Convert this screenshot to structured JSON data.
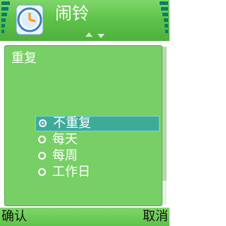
{
  "header": {
    "title": "闹铃",
    "app_icon": "clock-icon",
    "left_indicator": "signal-bars-icon",
    "right_indicator": "battery-bars-icon"
  },
  "panel": {
    "title": "重复",
    "options": [
      {
        "label": "不重复",
        "selected": true
      },
      {
        "label": "每天",
        "selected": false
      },
      {
        "label": "每周",
        "selected": false
      },
      {
        "label": "工作日",
        "selected": false
      }
    ]
  },
  "softkeys": {
    "left": "确认",
    "right": "取消"
  },
  "colors": {
    "header": "#5fc34a",
    "panel": "#78cf66",
    "highlight": "#3eaa9a"
  }
}
